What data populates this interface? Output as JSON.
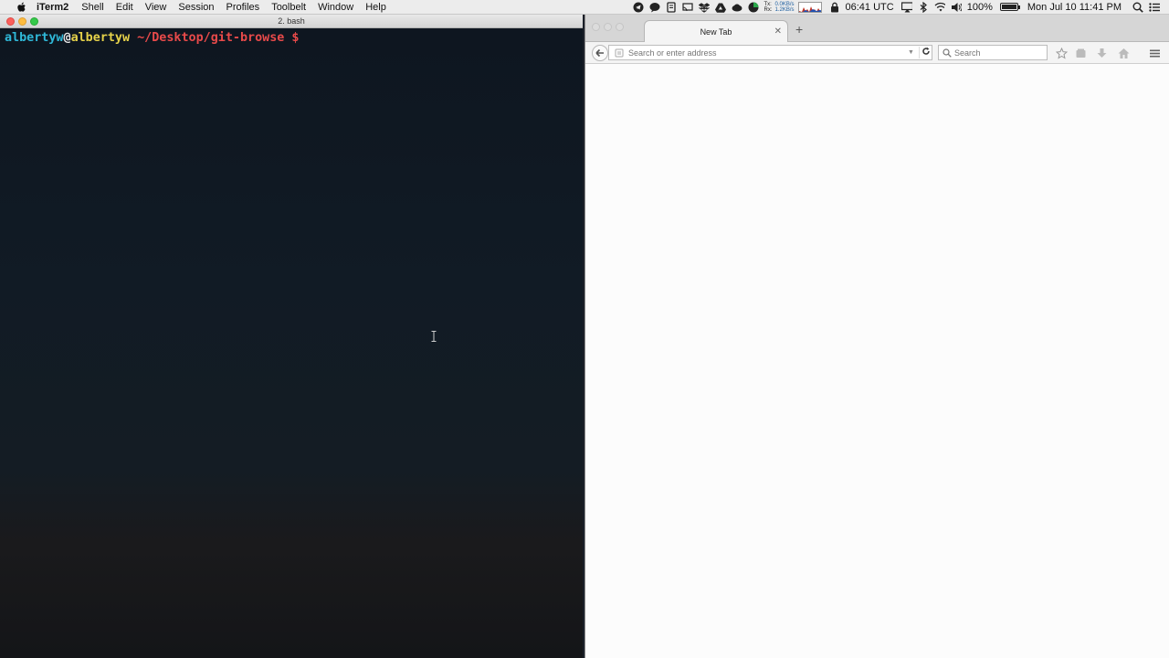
{
  "menubar": {
    "app_name": "iTerm2",
    "menus": [
      "Shell",
      "Edit",
      "View",
      "Session",
      "Profiles",
      "Toolbelt",
      "Window",
      "Help"
    ],
    "network": {
      "tx_label": "Tx:",
      "tx_value": "0.0KB/s",
      "rx_label": "Rx:",
      "rx_value": "1.2KB/s"
    },
    "utc_time": "06:41 UTC",
    "battery": "100%",
    "datetime": "Mon Jul 10  11:41 PM"
  },
  "iterm": {
    "title": "2. bash",
    "prompt": {
      "user": "albertyw",
      "at": "@",
      "host": "albertyw",
      "path": " ~/Desktop/git-browse",
      "symbol": " $"
    }
  },
  "firefox": {
    "tab_title": "New Tab",
    "new_tab_symbol": "+",
    "url_placeholder": "Search or enter address",
    "search_placeholder": "Search"
  }
}
